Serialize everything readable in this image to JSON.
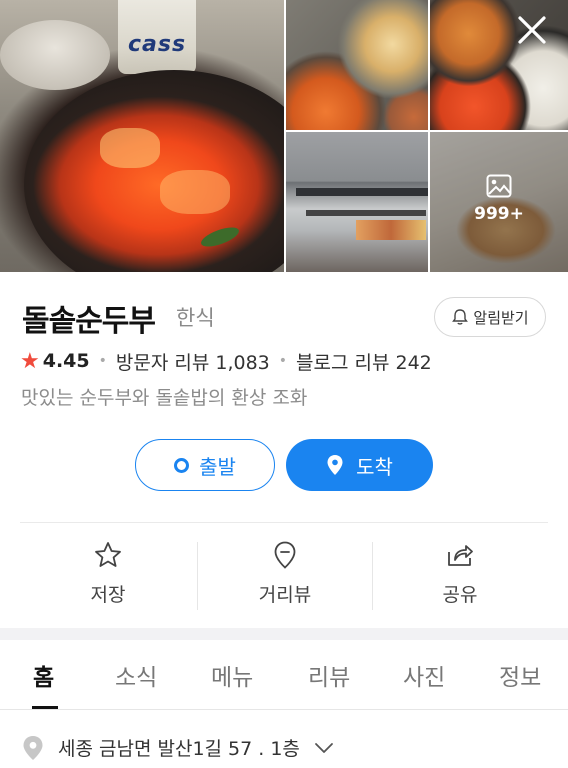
{
  "gallery": {
    "main_photo_text": "cass",
    "more_photos_count": "999+"
  },
  "place": {
    "name": "돌솥순두부",
    "category": "한식",
    "notify_label": "알림받기",
    "rating": "4.45",
    "visitor_reviews": "방문자 리뷰 1,083",
    "blog_reviews": "블로그 리뷰 242",
    "description": "맛있는 순두부와 돌솥밥의 환상 조화"
  },
  "route": {
    "depart_label": "출발",
    "arrive_label": "도착"
  },
  "actions": [
    {
      "label": "저장",
      "icon": "star-outline-icon"
    },
    {
      "label": "거리뷰",
      "icon": "street-view-pin-icon"
    },
    {
      "label": "공유",
      "icon": "share-icon"
    }
  ],
  "tabs": [
    {
      "label": "홈",
      "active": true
    },
    {
      "label": "소식"
    },
    {
      "label": "메뉴"
    },
    {
      "label": "리뷰"
    },
    {
      "label": "사진"
    },
    {
      "label": "정보"
    }
  ],
  "address": "세종 금남면 발산1길 57 . 1층",
  "colors": {
    "accent": "#1a84f0",
    "rating_star": "#f04b3c",
    "secondary_text": "#8c8c8c"
  }
}
